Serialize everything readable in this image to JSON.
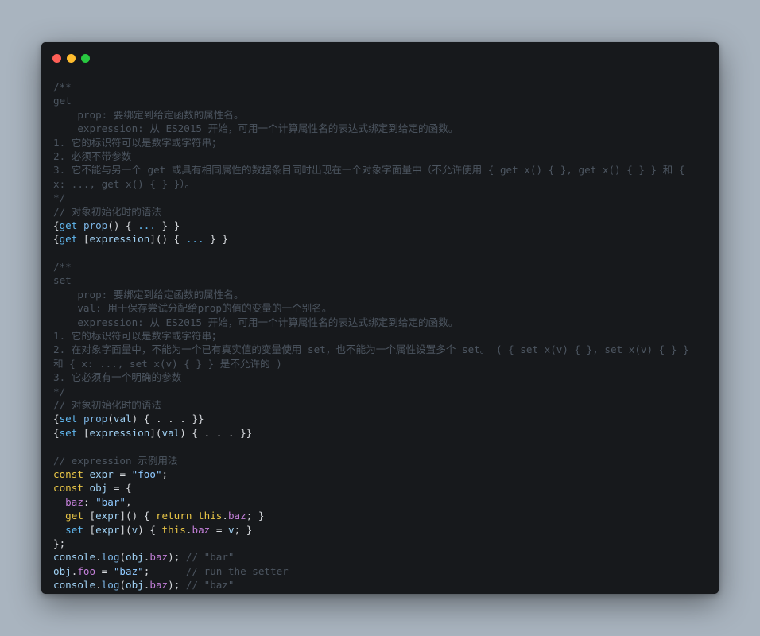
{
  "window": {
    "controls": [
      {
        "name": "close",
        "color": "#fe5f57"
      },
      {
        "name": "minimize",
        "color": "#febc2e"
      },
      {
        "name": "maximize",
        "color": "#28c840"
      }
    ]
  },
  "code": [
    [
      [
        "c",
        "/**"
      ]
    ],
    [
      [
        "c",
        "get"
      ]
    ],
    [
      [
        "c",
        "    prop: 要绑定到给定函数的属性名。"
      ]
    ],
    [
      [
        "c",
        "    expression: 从 ES2015 开始，可用一个计算属性名的表达式绑定到给定的函数。"
      ]
    ],
    [
      [
        "c",
        "1. 它的标识符可以是数字或字符串；"
      ]
    ],
    [
      [
        "c",
        "2. 必须不带参数"
      ]
    ],
    [
      [
        "c",
        "3. 它不能与另一个 get 或具有相同属性的数据条目同时出现在一个对象字面量中（不允许使用 { get x() { }, get x() { } } 和 {"
      ]
    ],
    [
      [
        "c",
        "x: ..., get x() { } }）。"
      ]
    ],
    [
      [
        "c",
        "*/"
      ]
    ],
    [
      [
        "c",
        "// 对象初始化时的语法"
      ]
    ],
    [
      [
        "p",
        "{"
      ],
      [
        "kb",
        "get"
      ],
      [
        "p",
        " "
      ],
      [
        "f",
        "prop"
      ],
      [
        "p",
        "() { "
      ],
      [
        "kb",
        "..."
      ],
      [
        "p",
        " } }"
      ]
    ],
    [
      [
        "p",
        "{"
      ],
      [
        "kb",
        "get"
      ],
      [
        "p",
        " ["
      ],
      [
        "v",
        "expression"
      ],
      [
        "p",
        "]() { "
      ],
      [
        "kb",
        "..."
      ],
      [
        "p",
        " } }"
      ]
    ],
    [],
    [
      [
        "c",
        "/**"
      ]
    ],
    [
      [
        "c",
        "set"
      ]
    ],
    [
      [
        "c",
        "    prop: 要绑定到给定函数的属性名。"
      ]
    ],
    [
      [
        "c",
        "    val: 用于保存尝试分配给prop的值的变量的一个别名。"
      ]
    ],
    [
      [
        "c",
        "    expression: 从 ES2015 开始，可用一个计算属性名的表达式绑定到给定的函数。"
      ]
    ],
    [
      [
        "c",
        "1. 它的标识符可以是数字或字符串；"
      ]
    ],
    [
      [
        "c",
        "2. 在对象字面量中，不能为一个已有真实值的变量使用 set，也不能为一个属性设置多个 set。 ( { set x(v) { }, set x(v) { } }"
      ]
    ],
    [
      [
        "c",
        "和 { x: ..., set x(v) { } } 是不允许的 )"
      ]
    ],
    [
      [
        "c",
        "3. 它必须有一个明确的参数"
      ]
    ],
    [
      [
        "c",
        "*/"
      ]
    ],
    [
      [
        "c",
        "// 对象初始化时的语法"
      ]
    ],
    [
      [
        "p",
        "{"
      ],
      [
        "kb",
        "set"
      ],
      [
        "p",
        " "
      ],
      [
        "f",
        "prop"
      ],
      [
        "p",
        "("
      ],
      [
        "v",
        "val"
      ],
      [
        "p",
        ") { . . . }}"
      ]
    ],
    [
      [
        "p",
        "{"
      ],
      [
        "kb",
        "set"
      ],
      [
        "p",
        " ["
      ],
      [
        "v",
        "expression"
      ],
      [
        "p",
        "]("
      ],
      [
        "v",
        "val"
      ],
      [
        "p",
        ") { . . . }}"
      ]
    ],
    [],
    [
      [
        "c",
        "// expression 示例用法"
      ]
    ],
    [
      [
        "k",
        "const"
      ],
      [
        "p",
        " "
      ],
      [
        "v",
        "expr"
      ],
      [
        "p",
        " = "
      ],
      [
        "s",
        "\"foo\""
      ],
      [
        "p",
        ";"
      ]
    ],
    [
      [
        "k",
        "const"
      ],
      [
        "p",
        " "
      ],
      [
        "v",
        "obj"
      ],
      [
        "p",
        " = {"
      ]
    ],
    [
      [
        "p",
        "  "
      ],
      [
        "prop",
        "baz"
      ],
      [
        "p",
        ": "
      ],
      [
        "s",
        "\"bar\""
      ],
      [
        "p",
        ","
      ]
    ],
    [
      [
        "p",
        "  "
      ],
      [
        "k",
        "get"
      ],
      [
        "p",
        " ["
      ],
      [
        "v",
        "expr"
      ],
      [
        "p",
        "]() { "
      ],
      [
        "k",
        "return"
      ],
      [
        "p",
        " "
      ],
      [
        "k",
        "this"
      ],
      [
        "p",
        "."
      ],
      [
        "prop",
        "baz"
      ],
      [
        "p",
        "; }"
      ]
    ],
    [
      [
        "p",
        "  "
      ],
      [
        "kb",
        "set"
      ],
      [
        "p",
        " ["
      ],
      [
        "v",
        "expr"
      ],
      [
        "p",
        "]("
      ],
      [
        "v",
        "v"
      ],
      [
        "p",
        ") { "
      ],
      [
        "k",
        "this"
      ],
      [
        "p",
        "."
      ],
      [
        "prop",
        "baz"
      ],
      [
        "p",
        " = "
      ],
      [
        "v",
        "v"
      ],
      [
        "p",
        "; }"
      ]
    ],
    [
      [
        "p",
        "};"
      ]
    ],
    [
      [
        "v",
        "console"
      ],
      [
        "p",
        "."
      ],
      [
        "f",
        "log"
      ],
      [
        "p",
        "("
      ],
      [
        "v",
        "obj"
      ],
      [
        "p",
        "."
      ],
      [
        "prop",
        "baz"
      ],
      [
        "p",
        "); "
      ],
      [
        "c",
        "// \"bar\""
      ]
    ],
    [
      [
        "v",
        "obj"
      ],
      [
        "p",
        "."
      ],
      [
        "prop",
        "foo"
      ],
      [
        "p",
        " = "
      ],
      [
        "s",
        "\"baz\""
      ],
      [
        "p",
        ";      "
      ],
      [
        "c",
        "// run the setter"
      ]
    ],
    [
      [
        "v",
        "console"
      ],
      [
        "p",
        "."
      ],
      [
        "f",
        "log"
      ],
      [
        "p",
        "("
      ],
      [
        "v",
        "obj"
      ],
      [
        "p",
        "."
      ],
      [
        "prop",
        "baz"
      ],
      [
        "p",
        "); "
      ],
      [
        "c",
        "// \"baz\""
      ]
    ]
  ]
}
